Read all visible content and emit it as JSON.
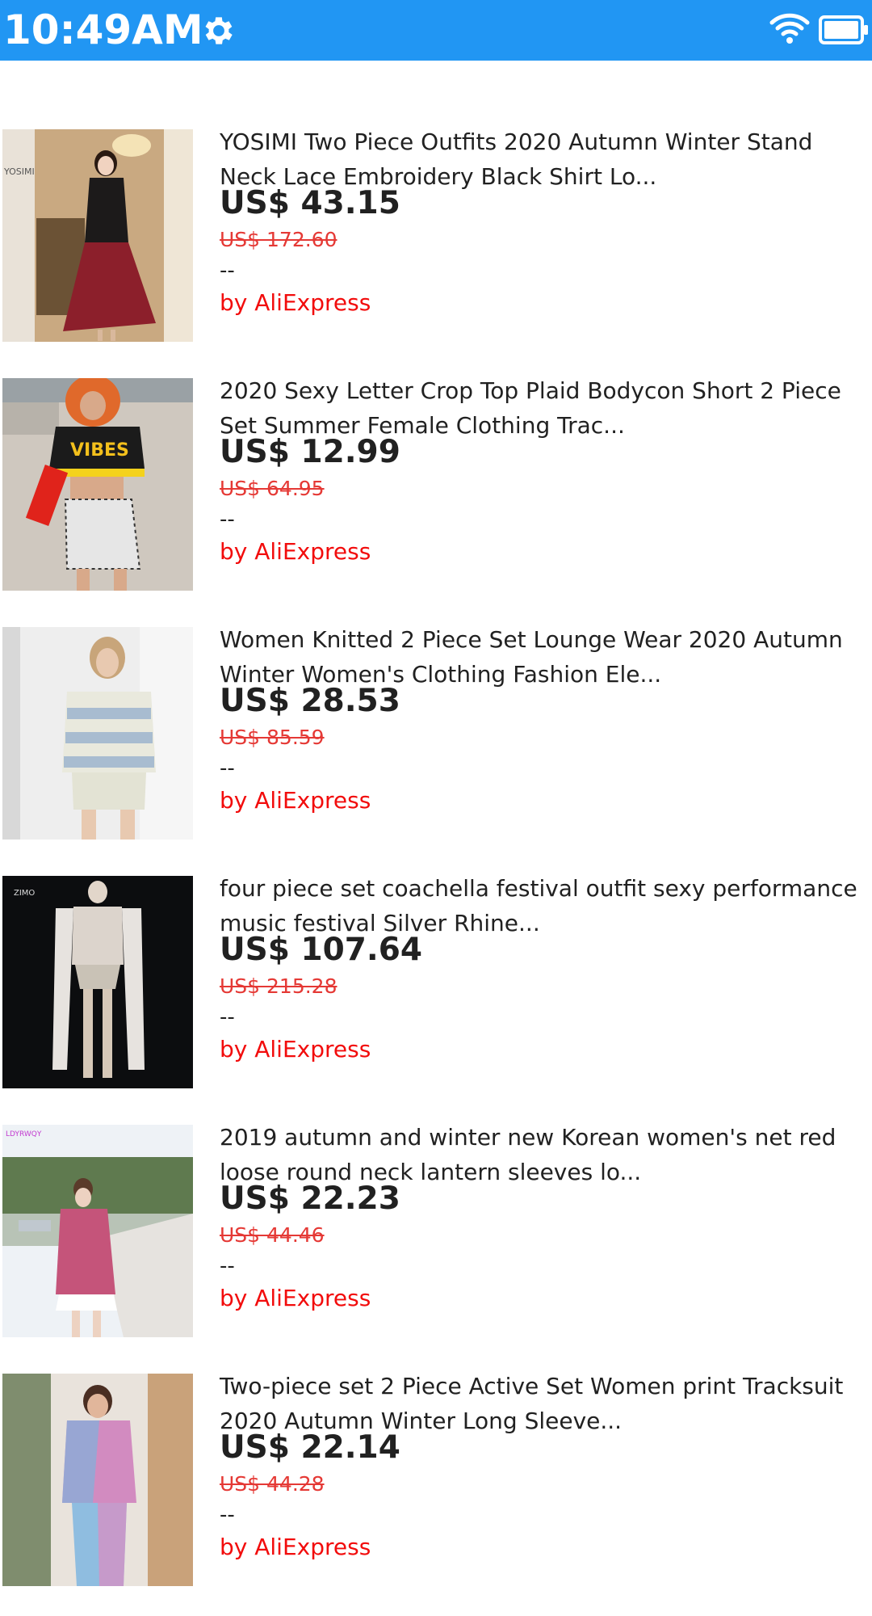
{
  "status_bar": {
    "time": "10:49AM",
    "icons": [
      "gear-icon",
      "wifi-icon",
      "battery-icon"
    ],
    "color": "#2196f3"
  },
  "products": [
    {
      "title": "YOSIMI Two Piece Outfits 2020 Autumn Winter Stand Neck Lace Embroidery Black Shirt Lo...",
      "price": "US$ 43.15",
      "original_price": "US$ 172.60",
      "rating": "--",
      "seller": "by AliExpress",
      "image_text": "YOSIMI"
    },
    {
      "title": "2020 Sexy Letter Crop Top Plaid Bodycon Short 2 Piece Set Summer Female Clothing Trac...",
      "price": "US$ 12.99",
      "original_price": "US$ 64.95",
      "rating": "--",
      "seller": "by AliExpress",
      "image_text": "VIBES"
    },
    {
      "title": "Women Knitted 2 Piece Set Lounge Wear 2020 Autumn Winter Women's Clothing Fashion Ele...",
      "price": "US$ 28.53",
      "original_price": "US$ 85.59",
      "rating": "--",
      "seller": "by AliExpress"
    },
    {
      "title": "four piece set coachella festival outfit sexy performance music festival Silver Rhine...",
      "price": "US$ 107.64",
      "original_price": "US$ 215.28",
      "rating": "--",
      "seller": "by AliExpress",
      "image_text": "ZIMO"
    },
    {
      "title": "2019 autumn and winter new Korean women's net red loose round neck lantern sleeves lo...",
      "price": "US$ 22.23",
      "original_price": "US$ 44.46",
      "rating": "--",
      "seller": "by AliExpress",
      "image_text": "LDYRWQY"
    },
    {
      "title": "Two-piece set 2 Piece Active Set Women print Tracksuit 2020 Autumn Winter Long Sleeve...",
      "price": "US$ 22.14",
      "original_price": "US$ 44.28",
      "rating": "--",
      "seller": "by AliExpress"
    }
  ]
}
